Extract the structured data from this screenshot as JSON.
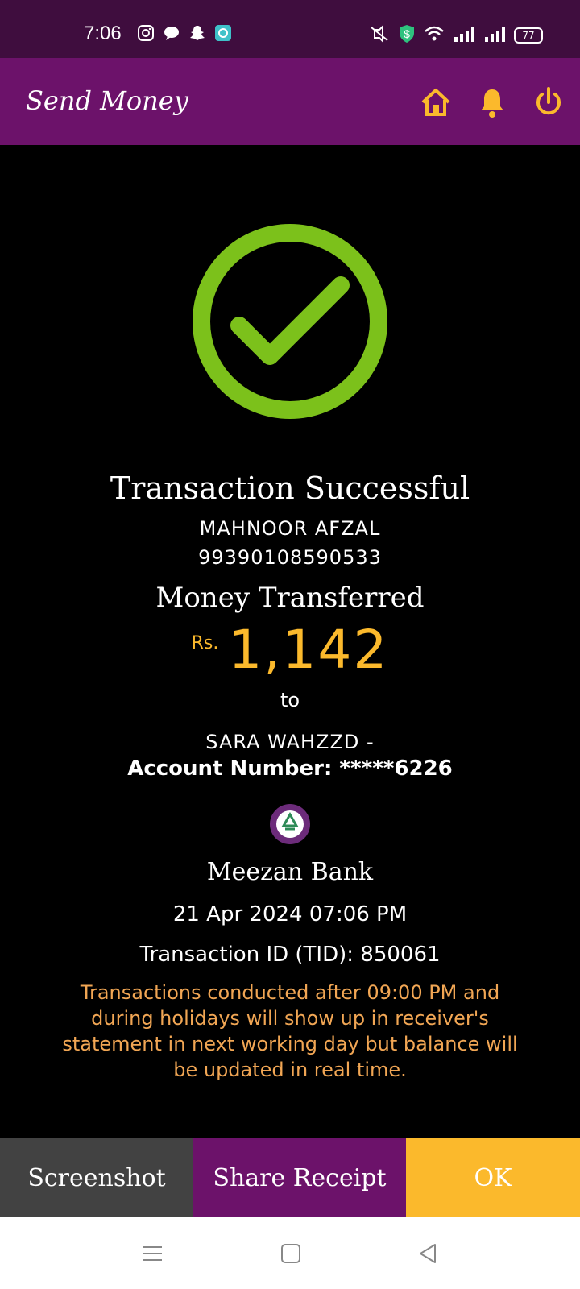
{
  "status_bar": {
    "time": "7:06",
    "battery": "77"
  },
  "app_bar": {
    "title": "Send Money",
    "icons": [
      "home-icon",
      "bell-icon",
      "power-icon"
    ]
  },
  "receipt": {
    "title": "Transaction Successful",
    "sender_name": "MAHNOOR AFZAL",
    "sender_account": "99390108590533",
    "money_label": "Money Transferred",
    "currency": "Rs.",
    "amount": "1,142",
    "to_label": "to",
    "receiver_name": "SARA WAHZZD -",
    "receiver_account": "Account Number: *****6226",
    "bank_name": "Meezan Bank",
    "datetime": "21 Apr 2024 07:06 PM",
    "tid": "Transaction ID (TID): 850061",
    "note": "Transactions conducted after 09:00 PM and during holidays will show up in receiver's statement in next working day but balance will be updated in real time."
  },
  "buttons": {
    "screenshot": "Screenshot",
    "share": "Share Receipt",
    "ok": "OK"
  },
  "colors": {
    "status_bar": "#3f0d3e",
    "app_bar": "#6c126a",
    "accent": "#fbb92c",
    "success": "#7cc11b",
    "note": "#f1a654",
    "button_screenshot": "#424242"
  }
}
